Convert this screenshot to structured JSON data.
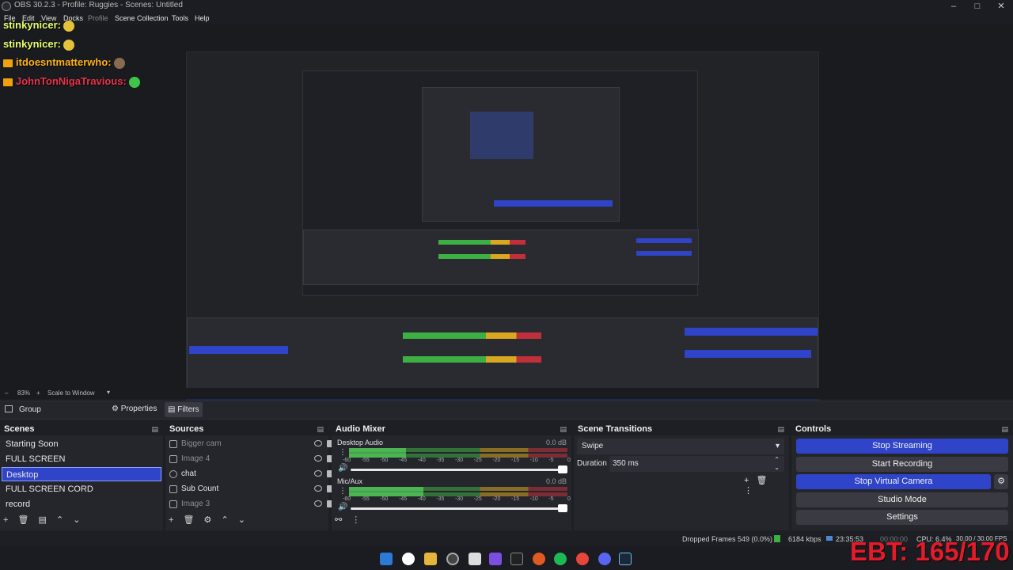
{
  "window": {
    "title": "OBS 30.2.3 - Profile: Ruggies - Scenes: Untitled",
    "controls": [
      "–",
      "□",
      "✕"
    ]
  },
  "menu": [
    "File",
    "Edit",
    "View",
    "Docks",
    "Profile",
    "Scene Collection",
    "Tools",
    "Help"
  ],
  "chat": [
    {
      "user": "stinkynicer:",
      "badge": false,
      "emote": "yellow"
    },
    {
      "user": "stinkynicer:",
      "badge": false,
      "emote": "yellow"
    },
    {
      "user": "itdoesntmatterwho:",
      "badge": true,
      "emote": "brown"
    },
    {
      "user": "JohnTonNigaTravious:",
      "badge": true,
      "emote": "green"
    }
  ],
  "zoom": {
    "value": "83%",
    "scale_label": "Scale to Window"
  },
  "context": {
    "source": "Group",
    "properties": "Properties",
    "filters": "Filters"
  },
  "scenes": {
    "title": "Scenes",
    "items": [
      "Starting Soon",
      "FULL SCREEN",
      "Desktop",
      "FULL SCREEN CORD",
      "record"
    ],
    "selected_index": 2
  },
  "sources": {
    "title": "Sources",
    "items": [
      {
        "name": "Bigger cam",
        "visible": false
      },
      {
        "name": "Image 4",
        "visible": false
      },
      {
        "name": "chat",
        "visible": true
      },
      {
        "name": "Sub Count",
        "visible": true
      },
      {
        "name": "Image 3",
        "visible": false
      }
    ]
  },
  "mixer": {
    "title": "Audio Mixer",
    "channels": [
      {
        "name": "Desktop Audio",
        "db": "0.0 dB",
        "level": 0.26
      },
      {
        "name": "Mic/Aux",
        "db": "0.0 dB",
        "level": 0.34
      }
    ],
    "ticks": [
      "-60",
      "-55",
      "-50",
      "-45",
      "-40",
      "-35",
      "-30",
      "-25",
      "-20",
      "-15",
      "-10",
      "-5",
      "0"
    ]
  },
  "transitions": {
    "title": "Scene Transitions",
    "selected": "Swipe",
    "duration_label": "Duration",
    "duration_value": "350 ms"
  },
  "controls": {
    "title": "Controls",
    "buttons": [
      {
        "label": "Stop Streaming",
        "active": true
      },
      {
        "label": "Start Recording",
        "active": false
      },
      {
        "label": "Stop Virtual Camera",
        "active": true
      },
      {
        "label": "Studio Mode",
        "active": false
      },
      {
        "label": "Settings",
        "active": false
      }
    ]
  },
  "status": {
    "dropped": "Dropped Frames 549 (0.0%)",
    "bitrate": "6184 kbps",
    "stream_time": "23:35:53",
    "rec_time": "00:00:00",
    "cpu": "CPU: 6.4%",
    "fps": "30.00 / 30.00 FPS"
  },
  "overlay_text": "EBT: 165/170",
  "colors": {
    "accent": "#2f44c9",
    "bg": "#1e1f24",
    "panel": "#25262c",
    "overlay_red": "#e31b2a"
  }
}
